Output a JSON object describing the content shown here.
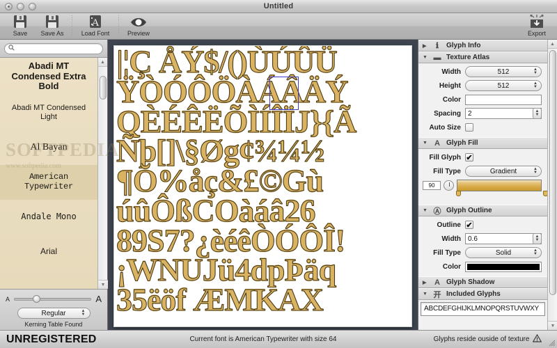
{
  "window": {
    "title": "Untitled",
    "traffic_lights": [
      "close",
      "minimize",
      "zoom"
    ]
  },
  "toolbar": {
    "items": [
      {
        "label": "Save",
        "icon": "floppy-disk-icon"
      },
      {
        "label": "Save As",
        "icon": "floppy-disk-icon"
      },
      {
        "label": "Load Font",
        "icon": "load-font-icon"
      },
      {
        "label": "Preview",
        "icon": "eye-icon"
      }
    ],
    "export": {
      "label": "Export",
      "icon": "export-box-icon"
    }
  },
  "sidebar": {
    "search": {
      "value": "",
      "placeholder": "",
      "icon": "search-icon"
    },
    "fonts": [
      {
        "name": "Abadi MT Condensed Extra Bold",
        "style": "f-abadi-b",
        "selected": false
      },
      {
        "name": "Abadi MT Condensed Light",
        "style": "f-abadi-l",
        "selected": false
      },
      {
        "name": "Al Bayan",
        "style": "f-bayan",
        "selected": false
      },
      {
        "name": "American Typewriter",
        "style": "f-typew",
        "selected": true
      },
      {
        "name": "Andale Mono",
        "style": "f-andale",
        "selected": false
      },
      {
        "name": "Arial",
        "style": "f-arial",
        "selected": false
      }
    ],
    "size_slider": {
      "min_label": "A",
      "max_label": "A",
      "value_pct": 24
    },
    "style_popup": {
      "value": "Regular"
    },
    "kerning_status": "Kerning Table Found"
  },
  "canvas": {
    "background_color": "#3e4550",
    "atlas_background": "#ffffff",
    "glyph_fill_color": "#d9b262",
    "glyph_outline_color": "#4a3b17",
    "selection_color": "#3b3bcd",
    "rows": [
      "|¦Ç ÅÝ$/()ÙÚÛÜ",
      "ŸÒÓÔÖÀÁÂÄÝ",
      "QÈÉÊËÕÌÍÎÏJ}{Ã",
      "Ñþ[]\\§Øgȼ¾¼½",
      "¶Ŏ%åç&£©Gù",
      "úûÔßCOàáâ26",
      "89S7?¿èéêÒÓÔÎ!",
      "¡WNUJü4dpÞäq",
      "35ëöf ÆMKAX"
    ],
    "selection": {
      "glyph": "Á",
      "row": 1,
      "index": 6
    }
  },
  "inspector": {
    "sections": [
      {
        "id": "glyph-info",
        "title": "Glyph Info",
        "icon": "info-icon",
        "expanded": false
      },
      {
        "id": "texture-atlas",
        "title": "Texture Atlas",
        "icon": "texture-icon",
        "expanded": true
      },
      {
        "id": "glyph-fill",
        "title": "Glyph Fill",
        "icon": "letter-a-icon",
        "expanded": true
      },
      {
        "id": "glyph-outline",
        "title": "Glyph Outline",
        "icon": "letter-a-outline-icon",
        "expanded": true
      },
      {
        "id": "glyph-shadow",
        "title": "Glyph Shadow",
        "icon": "letter-a-shadow-icon",
        "expanded": false
      },
      {
        "id": "included-glyphs",
        "title": "Included Glyphs",
        "icon": "kai-char-icon",
        "expanded": true
      }
    ],
    "texture_atlas": {
      "width_label": "Width",
      "width_value": "512",
      "height_label": "Height",
      "height_value": "512",
      "color_label": "Color",
      "color_value": "#ffffff",
      "spacing_label": "Spacing",
      "spacing_value": "2",
      "auto_size_label": "Auto Size",
      "auto_size_checked": false
    },
    "glyph_fill": {
      "fill_glyph_label": "Fill Glyph",
      "fill_glyph_checked": true,
      "fill_type_label": "Fill Type",
      "fill_type_value": "Gradient",
      "angle_value": "90",
      "gradient_start": "#f2e2bd",
      "gradient_end": "#c99a30"
    },
    "glyph_outline": {
      "outline_label": "Outline",
      "outline_checked": true,
      "width_label": "Width",
      "width_value": "0.6",
      "fill_type_label": "Fill Type",
      "fill_type_value": "Solid",
      "color_label": "Color",
      "color_value": "#000000"
    },
    "included_glyphs": {
      "value": "ABCDEFGHIJKLMNOPQRSTUVWXY"
    },
    "watermark": {
      "line1": "SOFTPEDIA",
      "line2": "www.softpedia.com"
    }
  },
  "statusbar": {
    "left": "UNREGISTERED",
    "center": "Current font is American Typewriter with size 64",
    "right": "Glyphs reside ouside of texture",
    "right_icon": "warning-triangle-icon"
  }
}
